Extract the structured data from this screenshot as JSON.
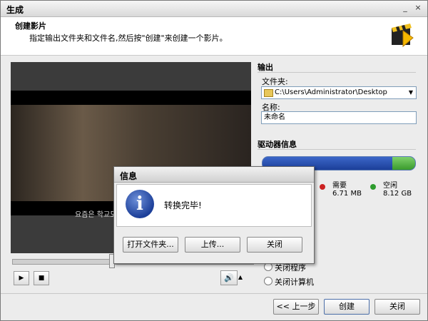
{
  "window": {
    "title": "生成",
    "minimize": "_",
    "close": "×"
  },
  "header": {
    "title": "创建影片",
    "subtitle": "指定输出文件夹和文件名,然后按\"创建\"来创建一个影片。",
    "logo": "movie-clapper-logo"
  },
  "preview": {
    "subtitle_text": "요즘은 학교도",
    "seek_position": 0.42
  },
  "player": {
    "play_icon": "▶",
    "stop_icon": "■",
    "volume_icon": "🔊",
    "volume_menu": "▲"
  },
  "output": {
    "section": "输出",
    "folder_label": "文件夹:",
    "folder_value": "C:\\Users\\Administrator\\Desktop",
    "dropdown_arrow": "▼",
    "name_label": "名称:",
    "name_value": "未命名"
  },
  "drive": {
    "section": "驱动器信息",
    "needed_label": "需要",
    "needed_value": "6.71 MB",
    "free_label": "空闲",
    "free_value": "8.12 GB",
    "needed_color": "#cc2222",
    "free_color": "#2e9c2e",
    "free_fraction": 0.15
  },
  "after": {
    "option1": "关闭程序",
    "option2": "关闭计算机"
  },
  "footer": {
    "back": "<< 上一步",
    "create": "创建",
    "close": "关闭"
  },
  "dialog": {
    "title": "信息",
    "icon": "i",
    "message": "转换完毕!",
    "open_folder": "打开文件夹...",
    "upload": "上传...",
    "close": "关闭"
  }
}
